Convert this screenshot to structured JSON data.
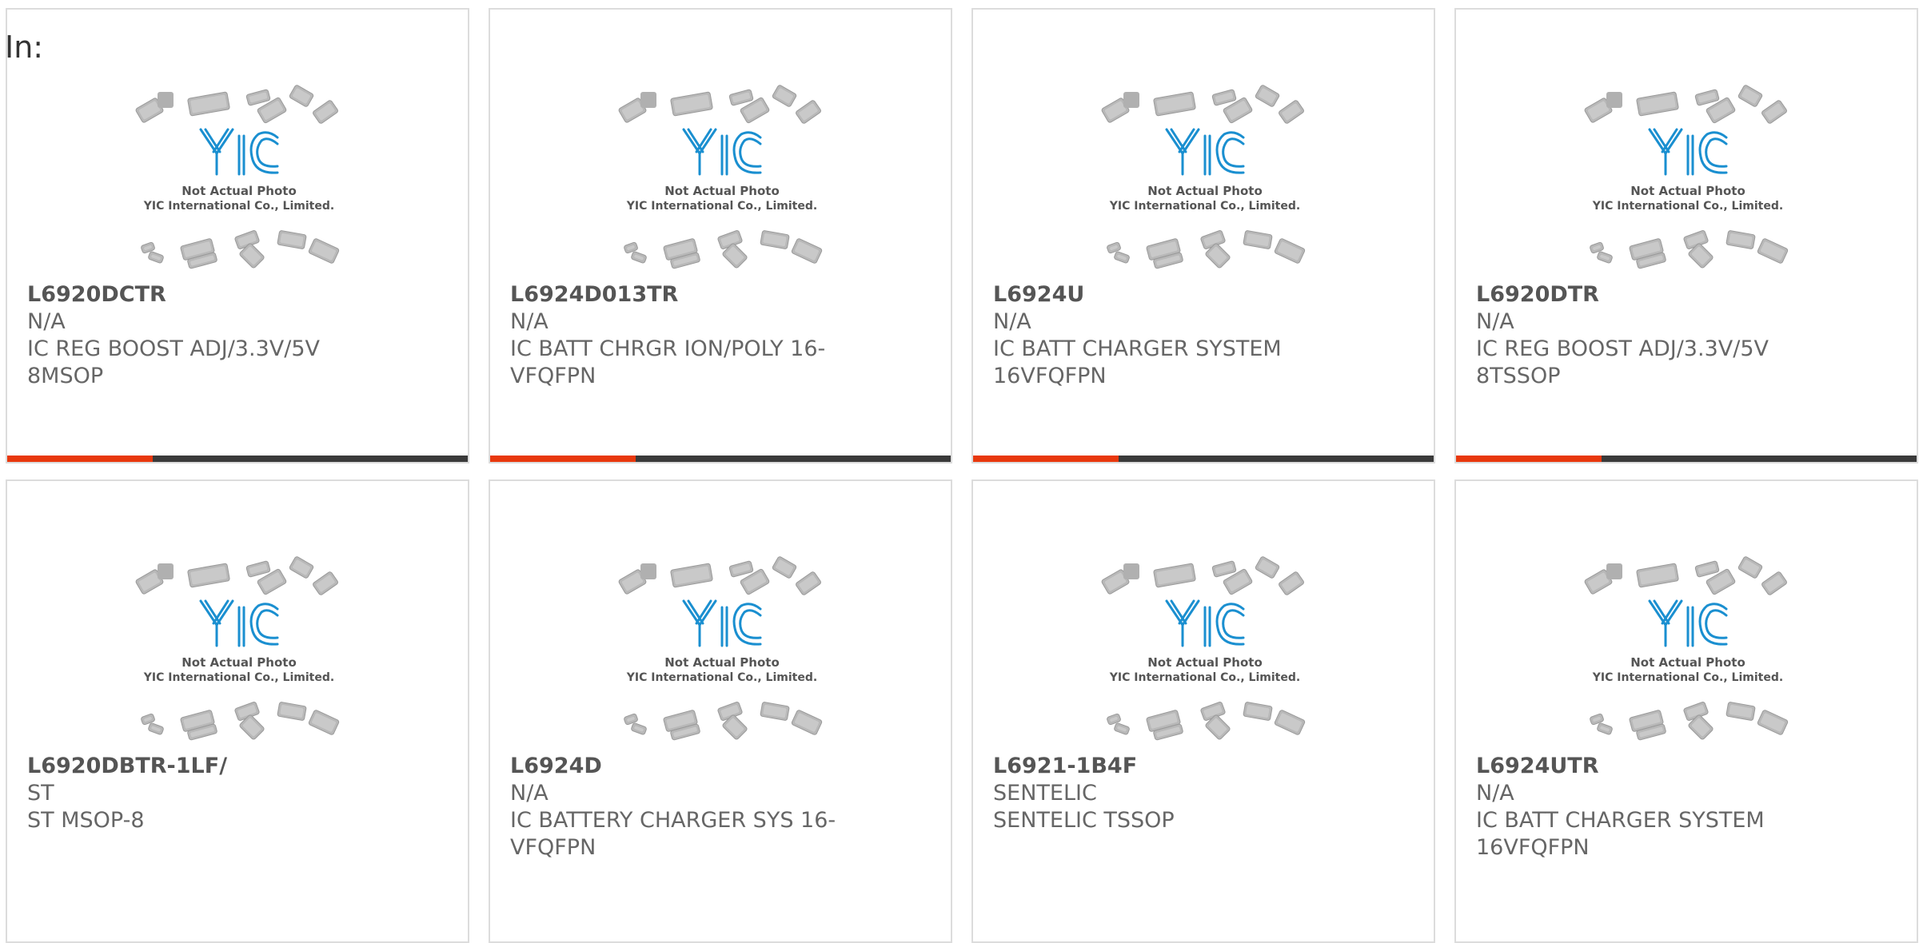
{
  "page": {
    "label": "In:"
  },
  "placeholder": {
    "line1": "Not Actual Photo",
    "line2": "YIC International Co., Limited."
  },
  "colors": {
    "accent": "#e8380d",
    "bar": "#3a3a3a",
    "logo": "#1a8fd0",
    "border": "#dcdcdc",
    "text": "#666666"
  },
  "products": [
    {
      "part": "L6920DCTR",
      "manufacturer": "N/A",
      "description": "IC REG BOOST ADJ/3.3V/5V 8MSOP"
    },
    {
      "part": "L6924D013TR",
      "manufacturer": "N/A",
      "description": "IC BATT CHRGR ION/POLY 16-VFQFPN"
    },
    {
      "part": "L6924U",
      "manufacturer": "N/A",
      "description": "IC BATT CHARGER SYSTEM 16VFQFPN"
    },
    {
      "part": "L6920DTR",
      "manufacturer": "N/A",
      "description": "IC REG BOOST ADJ/3.3V/5V 8TSSOP"
    },
    {
      "part": "L6920DBTR-1LF/",
      "manufacturer": "ST",
      "description": "ST MSOP-8"
    },
    {
      "part": "L6924D",
      "manufacturer": "N/A",
      "description": "IC BATTERY CHARGER SYS 16-VFQFPN"
    },
    {
      "part": "L6921-1B4F",
      "manufacturer": "SENTELIC",
      "description": "SENTELIC TSSOP"
    },
    {
      "part": "L6924UTR",
      "manufacturer": "N/A",
      "description": "IC BATT CHARGER SYSTEM 16VFQFPN"
    }
  ]
}
